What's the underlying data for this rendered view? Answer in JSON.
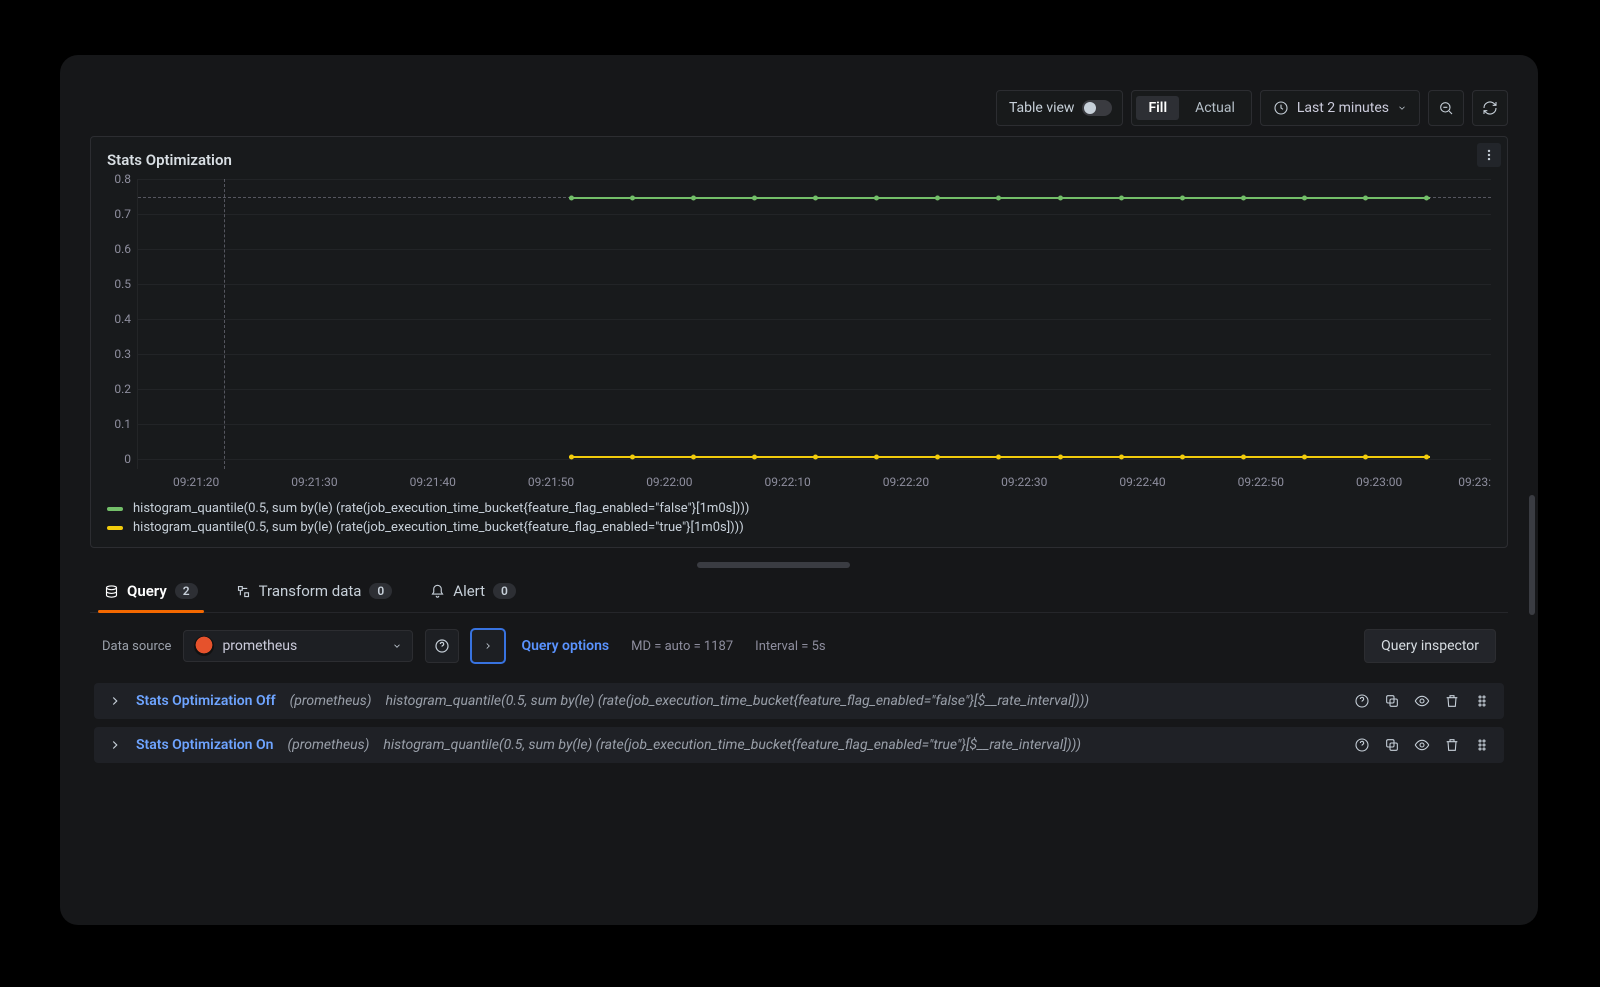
{
  "toolbar": {
    "table_view_label": "Table view",
    "fill_label": "Fill",
    "actual_label": "Actual",
    "time_range": "Last 2 minutes"
  },
  "panel": {
    "title": "Stats Optimization"
  },
  "chart_data": {
    "type": "line",
    "ylabel": "",
    "xlabel": "",
    "ylim": [
      0,
      0.8
    ],
    "yticks": [
      "0",
      "0.1",
      "0.2",
      "0.3",
      "0.4",
      "0.5",
      "0.6",
      "0.7",
      "0.8"
    ],
    "x": [
      "09:21:50",
      "09:21:55",
      "09:22:00",
      "09:22:05",
      "09:22:10",
      "09:22:15",
      "09:22:20",
      "09:22:25",
      "09:22:30",
      "09:22:35",
      "09:22:40",
      "09:22:45",
      "09:22:50",
      "09:22:55",
      "09:23:00"
    ],
    "x_ticks": [
      "09:21:20",
      "09:21:30",
      "09:21:40",
      "09:21:50",
      "09:22:00",
      "09:22:10",
      "09:22:20",
      "09:22:30",
      "09:22:40",
      "09:22:50",
      "09:23:00",
      "09:23:"
    ],
    "cursor_x": "09:21:22",
    "series": [
      {
        "name": "histogram_quantile(0.5, sum by(le) (rate(job_execution_time_bucket{feature_flag_enabled=\"false\"}[1m0s])))",
        "color": "#73bf69",
        "values": [
          0.75,
          0.75,
          0.75,
          0.75,
          0.75,
          0.75,
          0.75,
          0.75,
          0.75,
          0.75,
          0.75,
          0.75,
          0.75,
          0.75,
          0.75
        ]
      },
      {
        "name": "histogram_quantile(0.5, sum by(le) (rate(job_execution_time_bucket{feature_flag_enabled=\"true\"}[1m0s])))",
        "color": "#f2cc0c",
        "values": [
          0.01,
          0.01,
          0.01,
          0.01,
          0.01,
          0.01,
          0.01,
          0.01,
          0.01,
          0.01,
          0.01,
          0.01,
          0.01,
          0.01,
          0.01
        ]
      }
    ]
  },
  "tabs": {
    "query_label": "Query",
    "query_count": "2",
    "transform_label": "Transform data",
    "transform_count": "0",
    "alert_label": "Alert",
    "alert_count": "0"
  },
  "datasource": {
    "label": "Data source",
    "name": "prometheus",
    "query_options_label": "Query options",
    "md_text": "MD = auto = 1187",
    "interval_text": "Interval = 5s",
    "inspector_label": "Query inspector"
  },
  "queries": [
    {
      "name": "Stats Optimization Off",
      "datasource": "(prometheus)",
      "expr": "histogram_quantile(0.5, sum by(le) (rate(job_execution_time_bucket{feature_flag_enabled=\"false\"}[$__rate_interval])))"
    },
    {
      "name": "Stats Optimization On",
      "datasource": "(prometheus)",
      "expr": "histogram_quantile(0.5, sum by(le) (rate(job_execution_time_bucket{feature_flag_enabled=\"true\"}[$__rate_interval])))"
    }
  ]
}
